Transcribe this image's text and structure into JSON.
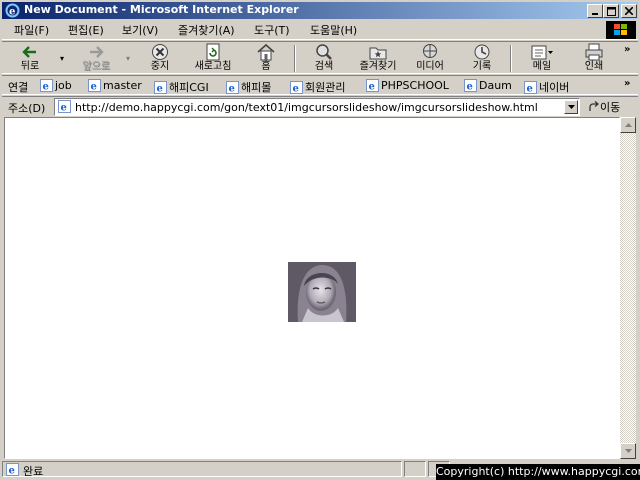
{
  "window": {
    "title": "New Document - Microsoft Internet Explorer"
  },
  "menu": {
    "items": [
      "파일(F)",
      "편집(E)",
      "보기(V)",
      "즐겨찾기(A)",
      "도구(T)",
      "도움말(H)"
    ]
  },
  "toolbar": {
    "back": "뒤로",
    "forward": "앞으로",
    "stop": "중지",
    "refresh": "새로고침",
    "home": "홈",
    "search": "검색",
    "favorites": "즐겨찾기",
    "media": "미디어",
    "history": "기록",
    "mail": "메일",
    "print": "인쇄"
  },
  "links": {
    "header": "연결",
    "items": [
      "job",
      "master",
      "해피CGI",
      "해피몰",
      "회원관리",
      "PHPSCHOOL",
      "Daum",
      "네이버"
    ]
  },
  "address": {
    "label": "주소(D)",
    "url": "http://demo.happycgi.com/gon/text01/imgcursorslideshow/imgcursorslideshow.html",
    "go": "이동"
  },
  "status": {
    "text": "완료"
  },
  "copyright": "Copyright(c) http://www.happycgi.com/"
}
